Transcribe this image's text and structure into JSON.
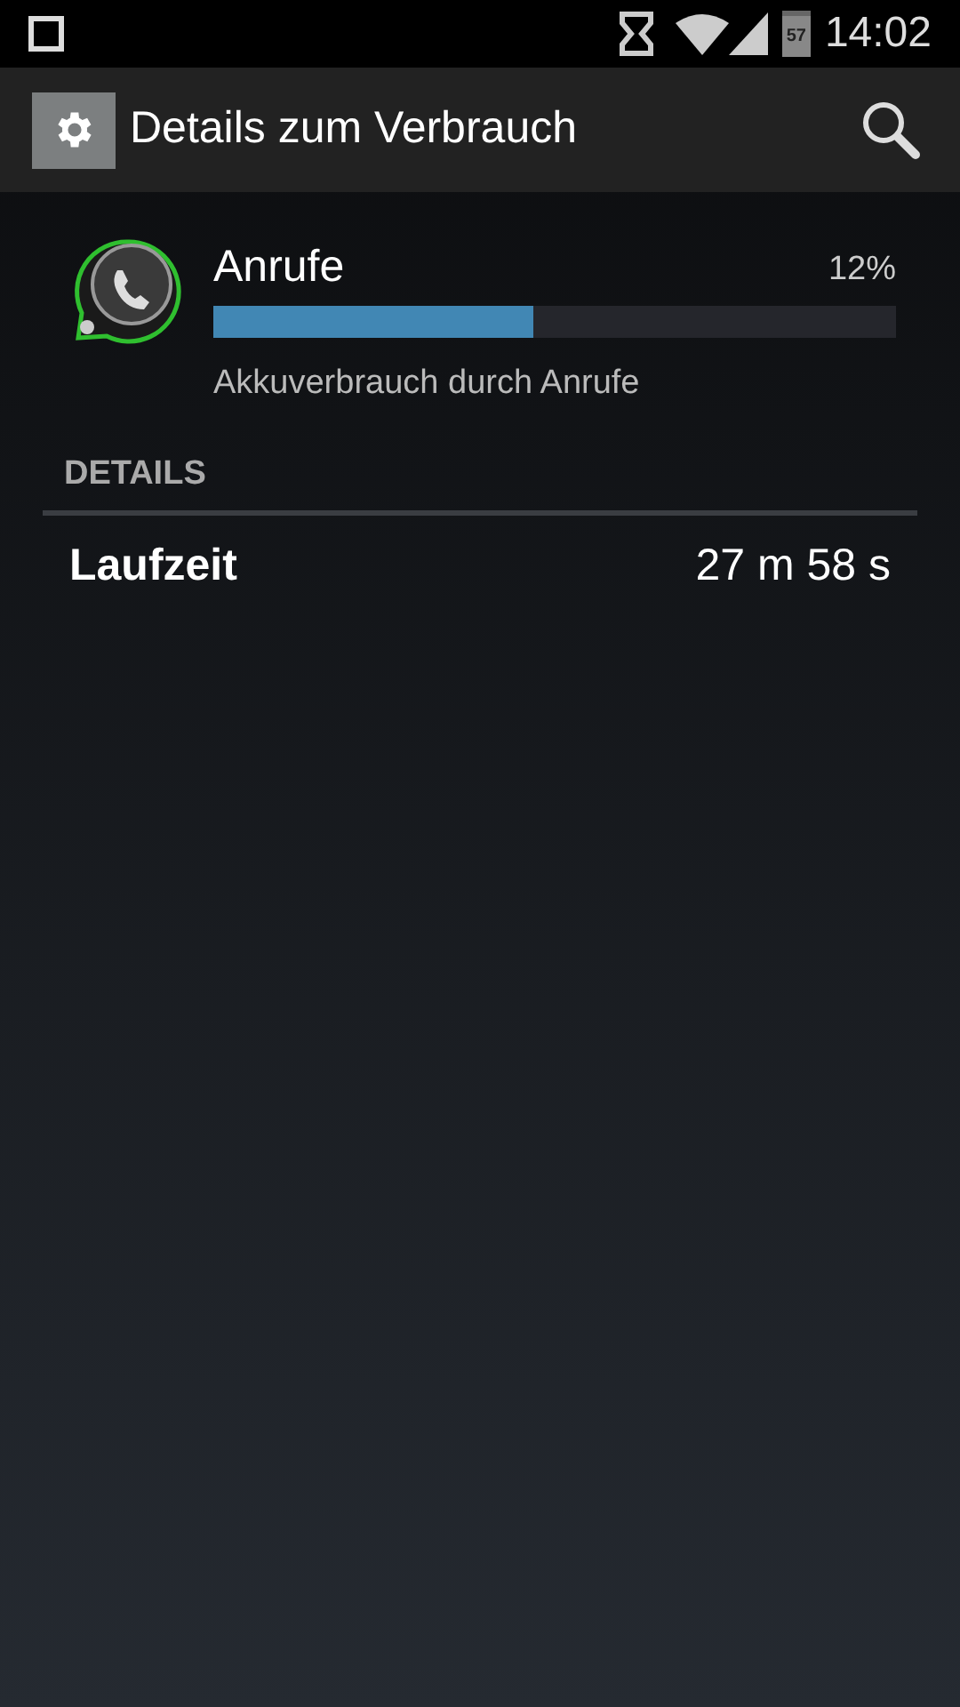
{
  "status_bar": {
    "battery": "57",
    "time": "14:02"
  },
  "app_bar": {
    "title": "Details zum Verbrauch"
  },
  "usage": {
    "name": "Anrufe",
    "percent": "12%",
    "level": 0.47,
    "description": "Akkuverbrauch durch Anrufe"
  },
  "details": {
    "heading": "DETAILS",
    "rows": [
      {
        "label": "Laufzeit",
        "value": "27 m 58 s"
      }
    ]
  }
}
